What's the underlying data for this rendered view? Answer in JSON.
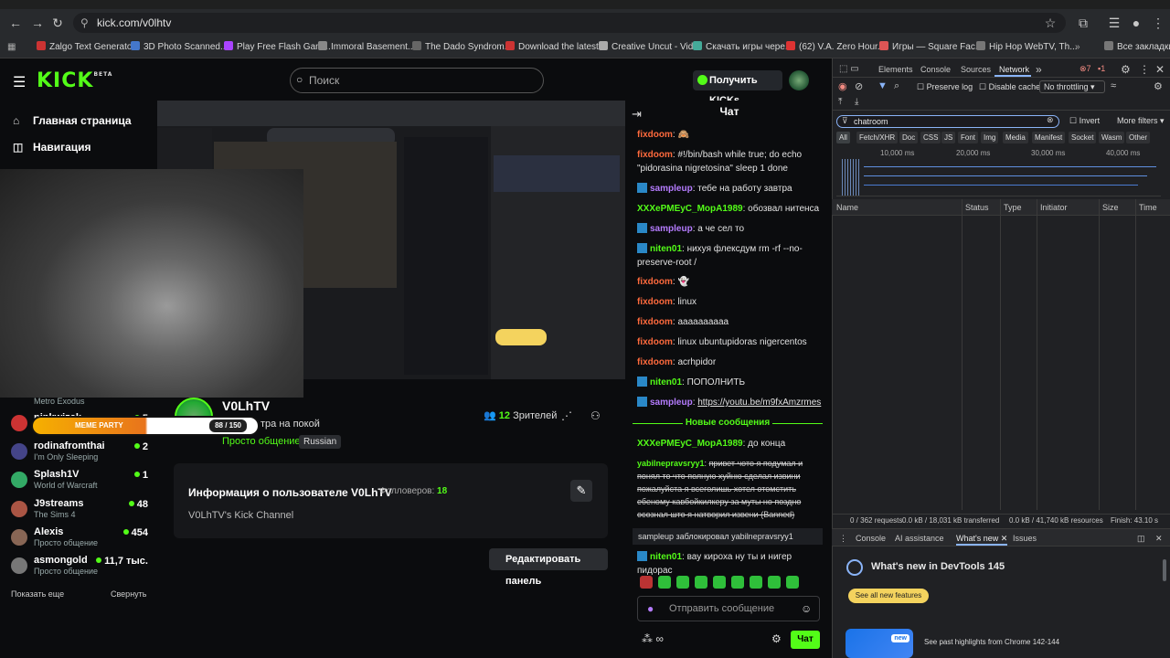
{
  "browser": {
    "url": "kick.com/v0lhtv",
    "bookmarks": [
      "Zalgo Text Generato...",
      "3D Photo Scanned...",
      "Play Free Flash Gam...",
      "Immoral Basement...",
      "The Dado Syndrom...",
      "Download the latest...",
      "Creative Uncut - Vid...",
      "Скачать игры чере...",
      "(62) V.A. Zero Hour...",
      "Игры — Square Fac...",
      "Hip Hop WebTV, Th..."
    ],
    "all_bookmarks": "Все закладки"
  },
  "kick": {
    "logo": "KICK",
    "logo_badge": "BETA",
    "search_placeholder": "Поиск",
    "get_kicks": "Получить KICKs",
    "nav": [
      "Главная страница",
      "Навигация"
    ],
    "followed": [
      {
        "name": "pinkwizak",
        "game": "",
        "viewers": "5",
        "color": "#c33"
      },
      {
        "name": "rodinafromthai",
        "game": "I'm Only Sleeping",
        "viewers": "2",
        "color": "#448"
      },
      {
        "name": "Splash1V",
        "game": "World of Warcraft",
        "viewers": "1",
        "color": "#3a6"
      },
      {
        "name": "J9streams",
        "game": "The Sims 4",
        "viewers": "48",
        "color": "#a54"
      },
      {
        "name": "Alexis",
        "game": "Просто общение",
        "viewers": "454",
        "color": "#865"
      },
      {
        "name": "asmongold",
        "game": "Просто общение",
        "viewers": "11,7 тыс.",
        "color": "#777"
      }
    ],
    "metro_label": "Metro Exodus",
    "show_more": "Показать еще",
    "collapse": "Свернуть",
    "meme_party": "MEME PARTY",
    "meme_count": "88 / 150",
    "channel": {
      "name": "V0LhTV",
      "title_partial": "тра на покой",
      "category": "Просто общение",
      "language": "Russian",
      "viewers_count": "12",
      "viewers_label": "Зрителей"
    },
    "about": {
      "title": "Информация о пользователе V0LhTV",
      "followers_label": "Фолловеров:",
      "followers": "18",
      "desc": "V0LhTV's Kick Channel",
      "edit_panel": "Редактировать панель"
    }
  },
  "chat": {
    "header": "Чат",
    "messages": [
      {
        "user": "fixdoom",
        "color": "#ff6a3d",
        "text": "",
        "badge": false
      },
      {
        "user": "fixdoom",
        "color": "#ff6a3d",
        "text": "#!/bin/bash while true; do echo \"pidorasina nigretosina\" sleep 1 done",
        "badge": false
      },
      {
        "user": "sampleup",
        "color": "#b57cff",
        "text": "тебе на работу завтра",
        "badge": true
      },
      {
        "user": "XXXePMEyC_MopA1989",
        "color": "#53fc18",
        "text": "обозвал нитенса",
        "badge": false
      },
      {
        "user": "sampleup",
        "color": "#b57cff",
        "text": "а че сел то",
        "badge": true
      },
      {
        "user": "niten01",
        "color": "#53fc18",
        "text": "нихуя флексдум rm -rf --no-preserve-root /",
        "badge": true
      },
      {
        "user": "fixdoom",
        "color": "#ff6a3d",
        "text": "",
        "badge": false
      },
      {
        "user": "fixdoom",
        "color": "#ff6a3d",
        "text": "linux",
        "badge": false
      },
      {
        "user": "fixdoom",
        "color": "#ff6a3d",
        "text": "аааааааааа",
        "badge": false
      },
      {
        "user": "fixdoom",
        "color": "#ff6a3d",
        "text": "linux ubuntupidoras nigercentos",
        "badge": false
      },
      {
        "user": "fixdoom",
        "color": "#ff6a3d",
        "text": "acrhpidor",
        "badge": false
      },
      {
        "user": "niten01",
        "color": "#53fc18",
        "text": "ПОПОЛНИТЬ",
        "badge": true
      },
      {
        "user": "sampleup",
        "color": "#b57cff",
        "text": "https://youtu.be/m9fxAmzrmes",
        "badge": true
      }
    ],
    "new_messages": "Новые сообщения",
    "after": [
      {
        "user": "XXXePMEyC_MopA1989",
        "color": "#53fc18",
        "text": "до конца"
      },
      {
        "user": "yabilnepravsryy1",
        "color": "#53fc18",
        "text": "привет чото я подумал и понял то что полную хуйню сделал извини пожалуйста я всеголишь хотел отомстить ебеному кавбойкилкеру за муты но поздно осознал што я натворил извени (Banned)"
      }
    ],
    "banned_notice": "sampleup заблокировал yabilnepravsryy1",
    "last": {
      "user": "niten01",
      "text": "вау кироха ну ты и нигер пидорас"
    },
    "input_placeholder": "Отправить сообщение",
    "send": "Чат"
  },
  "devtools": {
    "tabs": [
      "Elements",
      "Console",
      "Sources",
      "Network"
    ],
    "errors": "7",
    "warnings": "1",
    "preserve_log": "Preserve log",
    "disable_cache": "Disable cache",
    "throttle": "No throttling",
    "filter_value": "chatroom",
    "invert": "Invert",
    "more_filters": "More filters",
    "types": [
      "All",
      "Fetch/XHR",
      "Doc",
      "CSS",
      "JS",
      "Font",
      "Img",
      "Media",
      "Manifest",
      "Socket",
      "Wasm",
      "Other"
    ],
    "timeline_labels": [
      "10,000 ms",
      "20,000 ms",
      "30,000 ms",
      "40,000 ms"
    ],
    "columns": [
      "Name",
      "Status",
      "Type",
      "Initiator",
      "Size",
      "Time"
    ],
    "status": {
      "requests": "0 / 362 requests",
      "transferred": "0.0 kB / 18,031 kB transferred",
      "resources": "0.0 kB / 41,740 kB resources",
      "finish": "Finish: 43.10 s"
    },
    "drawer_tabs": [
      "Console",
      "AI assistance",
      "What's new",
      "Issues"
    ],
    "whats_new_title": "What's new in DevTools 145",
    "see_all": "See all new features",
    "new_badge": "new",
    "past_highlights": "See past highlights from Chrome 142-144"
  }
}
